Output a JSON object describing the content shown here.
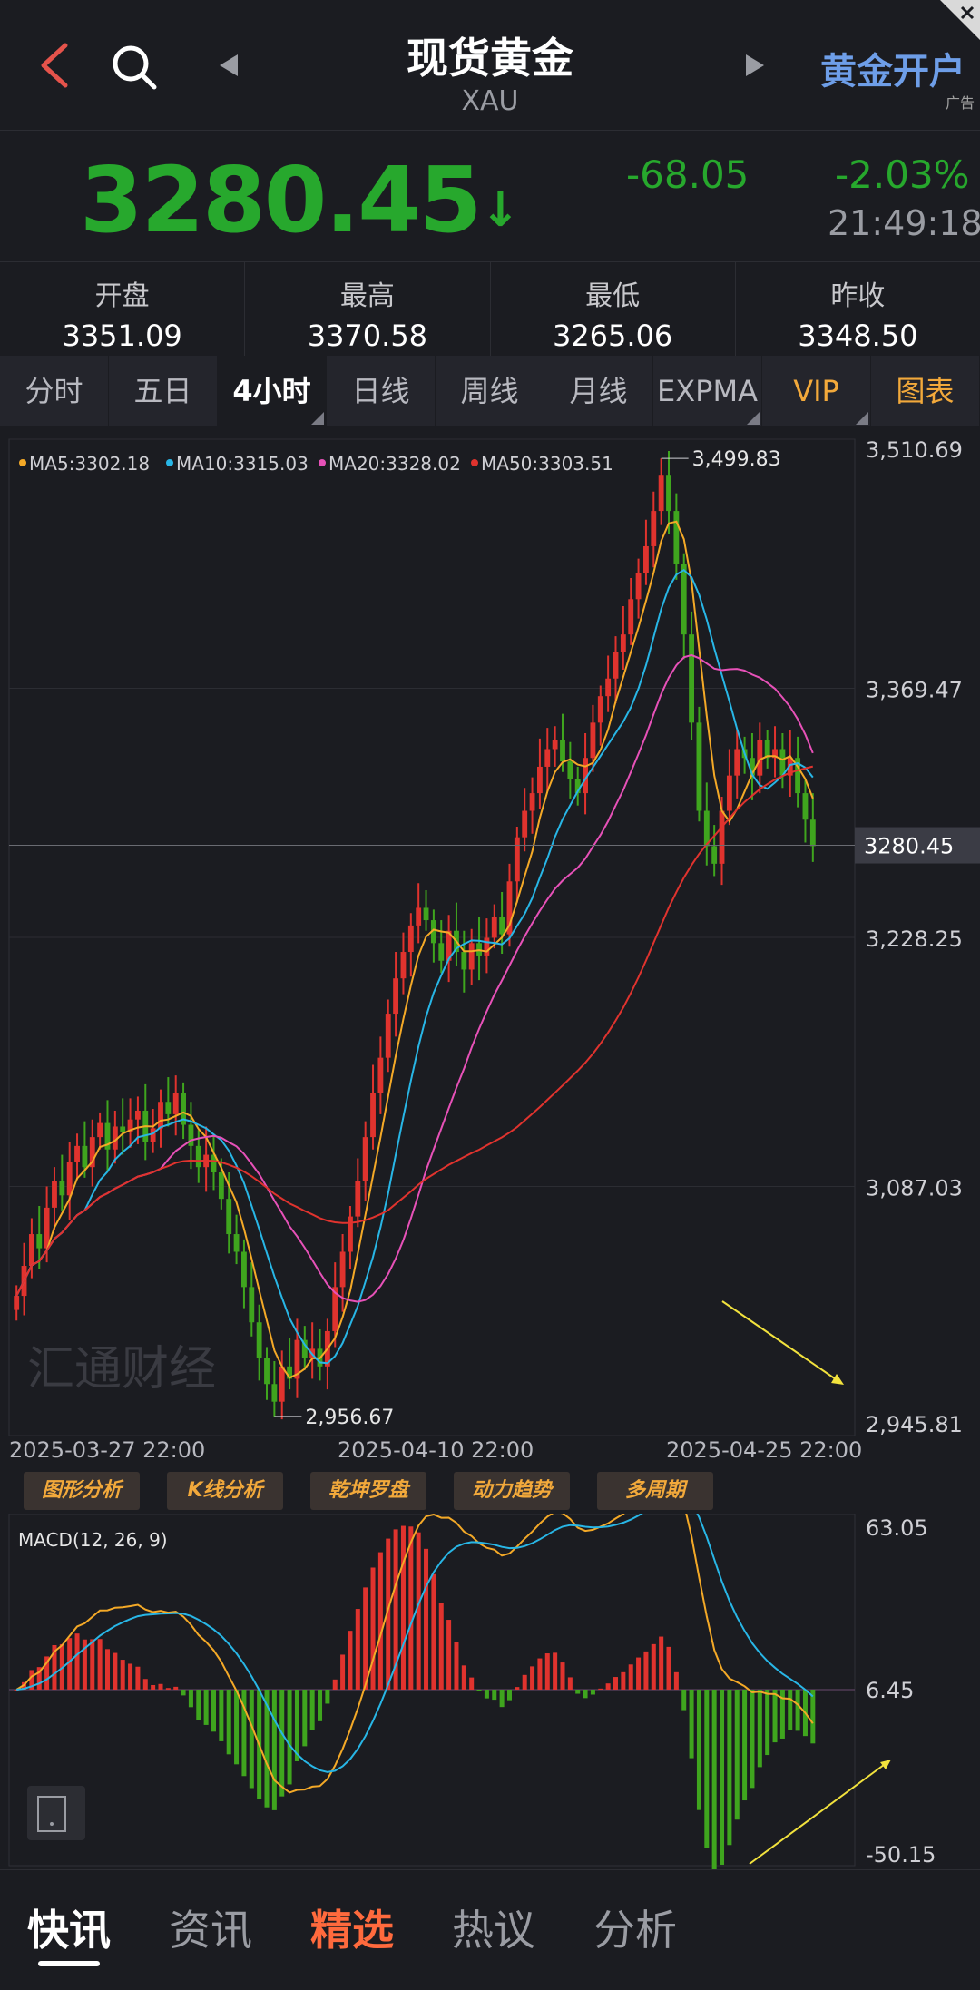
{
  "header": {
    "title": "现货黄金",
    "subtitle": "XAU",
    "open_account_label": "黄金开户",
    "ad_tag": "广告",
    "icons": [
      "back-arrow-icon",
      "search-icon",
      "prev-triangle-icon",
      "next-triangle-icon",
      "close-icon"
    ]
  },
  "quote": {
    "price": "3280.45",
    "arrow": "↓",
    "change": "-68.05",
    "change_pct": "-2.03%",
    "time": "21:49:18",
    "color_down": "#27a82d"
  },
  "stats": [
    {
      "label": "开盘",
      "value": "3351.09"
    },
    {
      "label": "最高",
      "value": "3370.58"
    },
    {
      "label": "最低",
      "value": "3265.06"
    },
    {
      "label": "昨收",
      "value": "3348.50"
    }
  ],
  "tabs": [
    {
      "label": "分时"
    },
    {
      "label": "五日"
    },
    {
      "label": "4小时",
      "active": true
    },
    {
      "label": "日线"
    },
    {
      "label": "周线"
    },
    {
      "label": "月线"
    },
    {
      "label": "EXPMA"
    },
    {
      "label": "VIP"
    },
    {
      "label": "图表"
    }
  ],
  "watermark": "汇通财经",
  "tools": [
    "图形分析",
    "K线分析",
    "乾坤罗盘",
    "动力趋势",
    "多周期"
  ],
  "bottom_nav": [
    {
      "label": "快讯",
      "active": true
    },
    {
      "label": "资讯"
    },
    {
      "label": "精选"
    },
    {
      "label": "热议"
    },
    {
      "label": "分析"
    }
  ],
  "chart_data": [
    {
      "type": "candlestick",
      "title": "",
      "legend": [
        {
          "name": "MA5",
          "value": "3302.18",
          "color": "#f4a927"
        },
        {
          "name": "MA10",
          "value": "3315.03",
          "color": "#28b6e6"
        },
        {
          "name": "MA20",
          "value": "3328.02",
          "color": "#e751b8"
        },
        {
          "name": "MA50",
          "value": "3303.51",
          "color": "#e0332e"
        }
      ],
      "y_ticks": [
        "3,510.69",
        "3,369.47",
        "3,228.25",
        "3,087.03",
        "2,945.81"
      ],
      "ylim": [
        2945.81,
        3510.69
      ],
      "x_ticks": [
        "2025-03-27 22:00",
        "2025-04-10 22:00",
        "2025-04-25 22:00"
      ],
      "current_price_label": "3280.45",
      "annotations": [
        {
          "label": "3,499.83",
          "value": 3499.83,
          "kind": "high"
        },
        {
          "label": "2,956.67",
          "value": 2956.67,
          "kind": "low"
        }
      ],
      "closes": [
        3025,
        3042,
        3060,
        3052,
        3075,
        3090,
        3082,
        3101,
        3110,
        3098,
        3115,
        3123,
        3108,
        3121,
        3118,
        3125,
        3130,
        3112,
        3120,
        3135,
        3128,
        3140,
        3122,
        3110,
        3098,
        3105,
        3095,
        3080,
        3060,
        3050,
        3030,
        3010,
        2990,
        2975,
        2965,
        2985,
        2978,
        3000,
        2990,
        2995,
        2985,
        3005,
        3030,
        3050,
        3070,
        3090,
        3115,
        3140,
        3160,
        3185,
        3205,
        3220,
        3235,
        3245,
        3238,
        3225,
        3215,
        3232,
        3220,
        3210,
        3225,
        3218,
        3228,
        3240,
        3230,
        3260,
        3285,
        3300,
        3310,
        3325,
        3335,
        3340,
        3328,
        3318,
        3310,
        3330,
        3350,
        3365,
        3375,
        3390,
        3400,
        3420,
        3435,
        3450,
        3470,
        3490,
        3470,
        3440,
        3400,
        3350,
        3300,
        3280,
        3270,
        3300,
        3320,
        3335,
        3330,
        3320,
        3340,
        3330,
        3335,
        3320,
        3330,
        3310,
        3295,
        3280
      ]
    },
    {
      "type": "macd",
      "title": "MACD(12, 26, 9)",
      "y_ticks": [
        "63.05",
        "6.45",
        "-50.15"
      ],
      "ylim": [
        -50.15,
        63.05
      ]
    }
  ]
}
